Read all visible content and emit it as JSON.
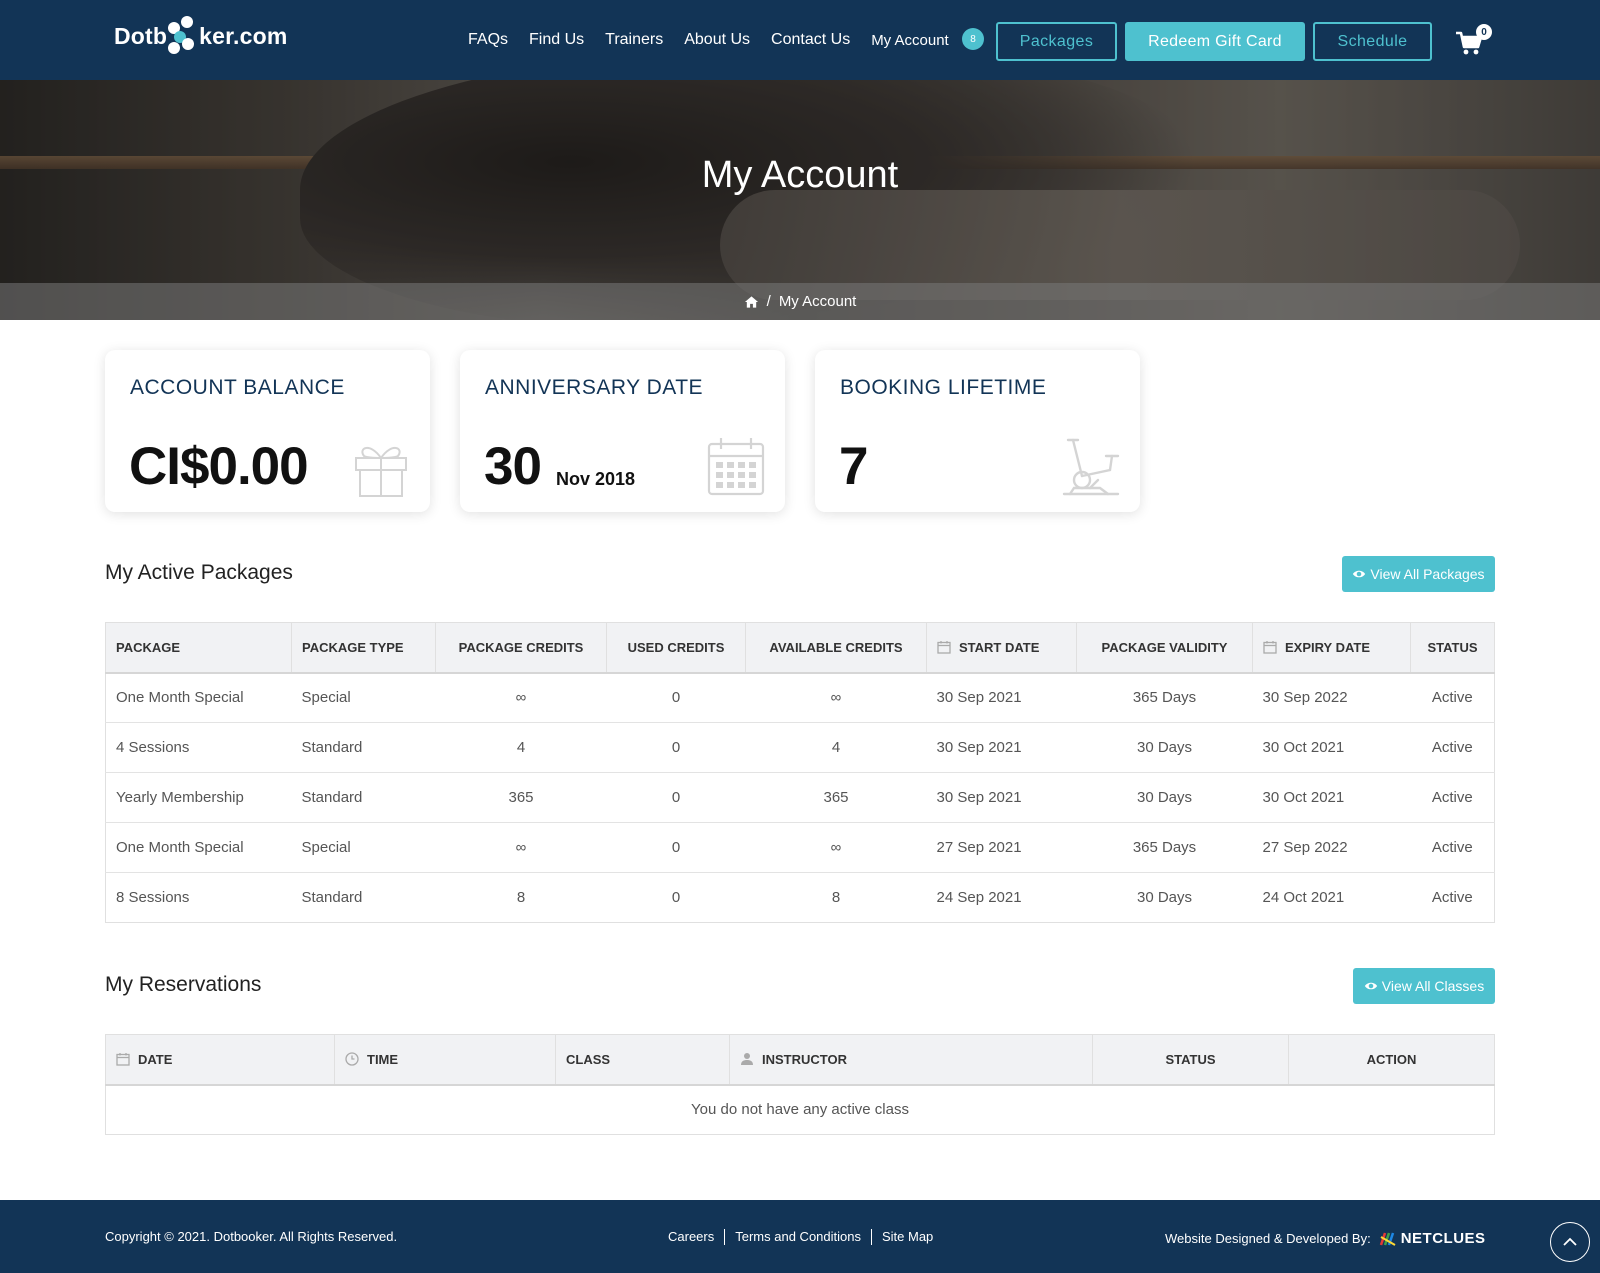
{
  "header": {
    "logo_left": "Dotb",
    "logo_right": "ker.com",
    "nav": [
      "FAQs",
      "Find Us",
      "Trainers",
      "About Us",
      "Contact Us"
    ],
    "account_label": "My Account",
    "account_badge": "8",
    "packages_label": "Packages",
    "redeem_label": "Redeem Gift Card",
    "schedule_label": "Schedule",
    "cart_count": "0",
    "icons": {
      "cart": "cart-icon"
    }
  },
  "hero": {
    "title": "My Account",
    "breadcrumb_home_icon": "home-icon",
    "breadcrumb_sep": "/",
    "breadcrumb_current": "My Account"
  },
  "stats": {
    "balance": {
      "title": "ACCOUNT BALANCE",
      "value": "CI$0.00",
      "icon": "gift-icon"
    },
    "anniversary": {
      "title": "ANNIVERSARY DATE",
      "day": "30",
      "month_year": "Nov 2018",
      "icon": "calendar-icon"
    },
    "booking": {
      "title": "BOOKING LIFETIME",
      "value": "7",
      "icon": "exercise-bike-icon"
    }
  },
  "packages": {
    "title": "My Active Packages",
    "view_all": "View All Packages",
    "columns": [
      "PACKAGE",
      "PACKAGE TYPE",
      "PACKAGE CREDITS",
      "USED CREDITS",
      "AVAILABLE CREDITS",
      "START DATE",
      "PACKAGE VALIDITY",
      "EXPIRY DATE",
      "STATUS"
    ],
    "rows": [
      [
        "One Month Special",
        "Special",
        "∞",
        "0",
        "∞",
        "30 Sep 2021",
        "365 Days",
        "30 Sep 2022",
        "Active"
      ],
      [
        "4 Sessions",
        "Standard",
        "4",
        "0",
        "4",
        "30 Sep 2021",
        "30 Days",
        "30 Oct 2021",
        "Active"
      ],
      [
        "Yearly Membership",
        "Standard",
        "365",
        "0",
        "365",
        "30 Sep 2021",
        "30 Days",
        "30 Oct 2021",
        "Active"
      ],
      [
        "One Month Special",
        "Special",
        "∞",
        "0",
        "∞",
        "27 Sep 2021",
        "365 Days",
        "27 Sep 2022",
        "Active"
      ],
      [
        "8 Sessions",
        "Standard",
        "8",
        "0",
        "8",
        "24 Sep 2021",
        "30 Days",
        "24 Oct 2021",
        "Active"
      ]
    ]
  },
  "reservations": {
    "title": "My Reservations",
    "view_all": "View All Classes",
    "columns": [
      "DATE",
      "TIME",
      "CLASS",
      "INSTRUCTOR",
      "STATUS",
      "ACTION"
    ],
    "empty_message": "You do not have any active class"
  },
  "footer": {
    "copyright": "Copyright © 2021. Dotbooker. All Rights Reserved.",
    "links": [
      "Careers",
      "Terms and Conditions",
      "Site Map"
    ],
    "credit": "Website Designed & Developed By:",
    "brand": "NETCLUES"
  },
  "colors": {
    "navy": "#123456",
    "teal": "#4ec1cf"
  }
}
